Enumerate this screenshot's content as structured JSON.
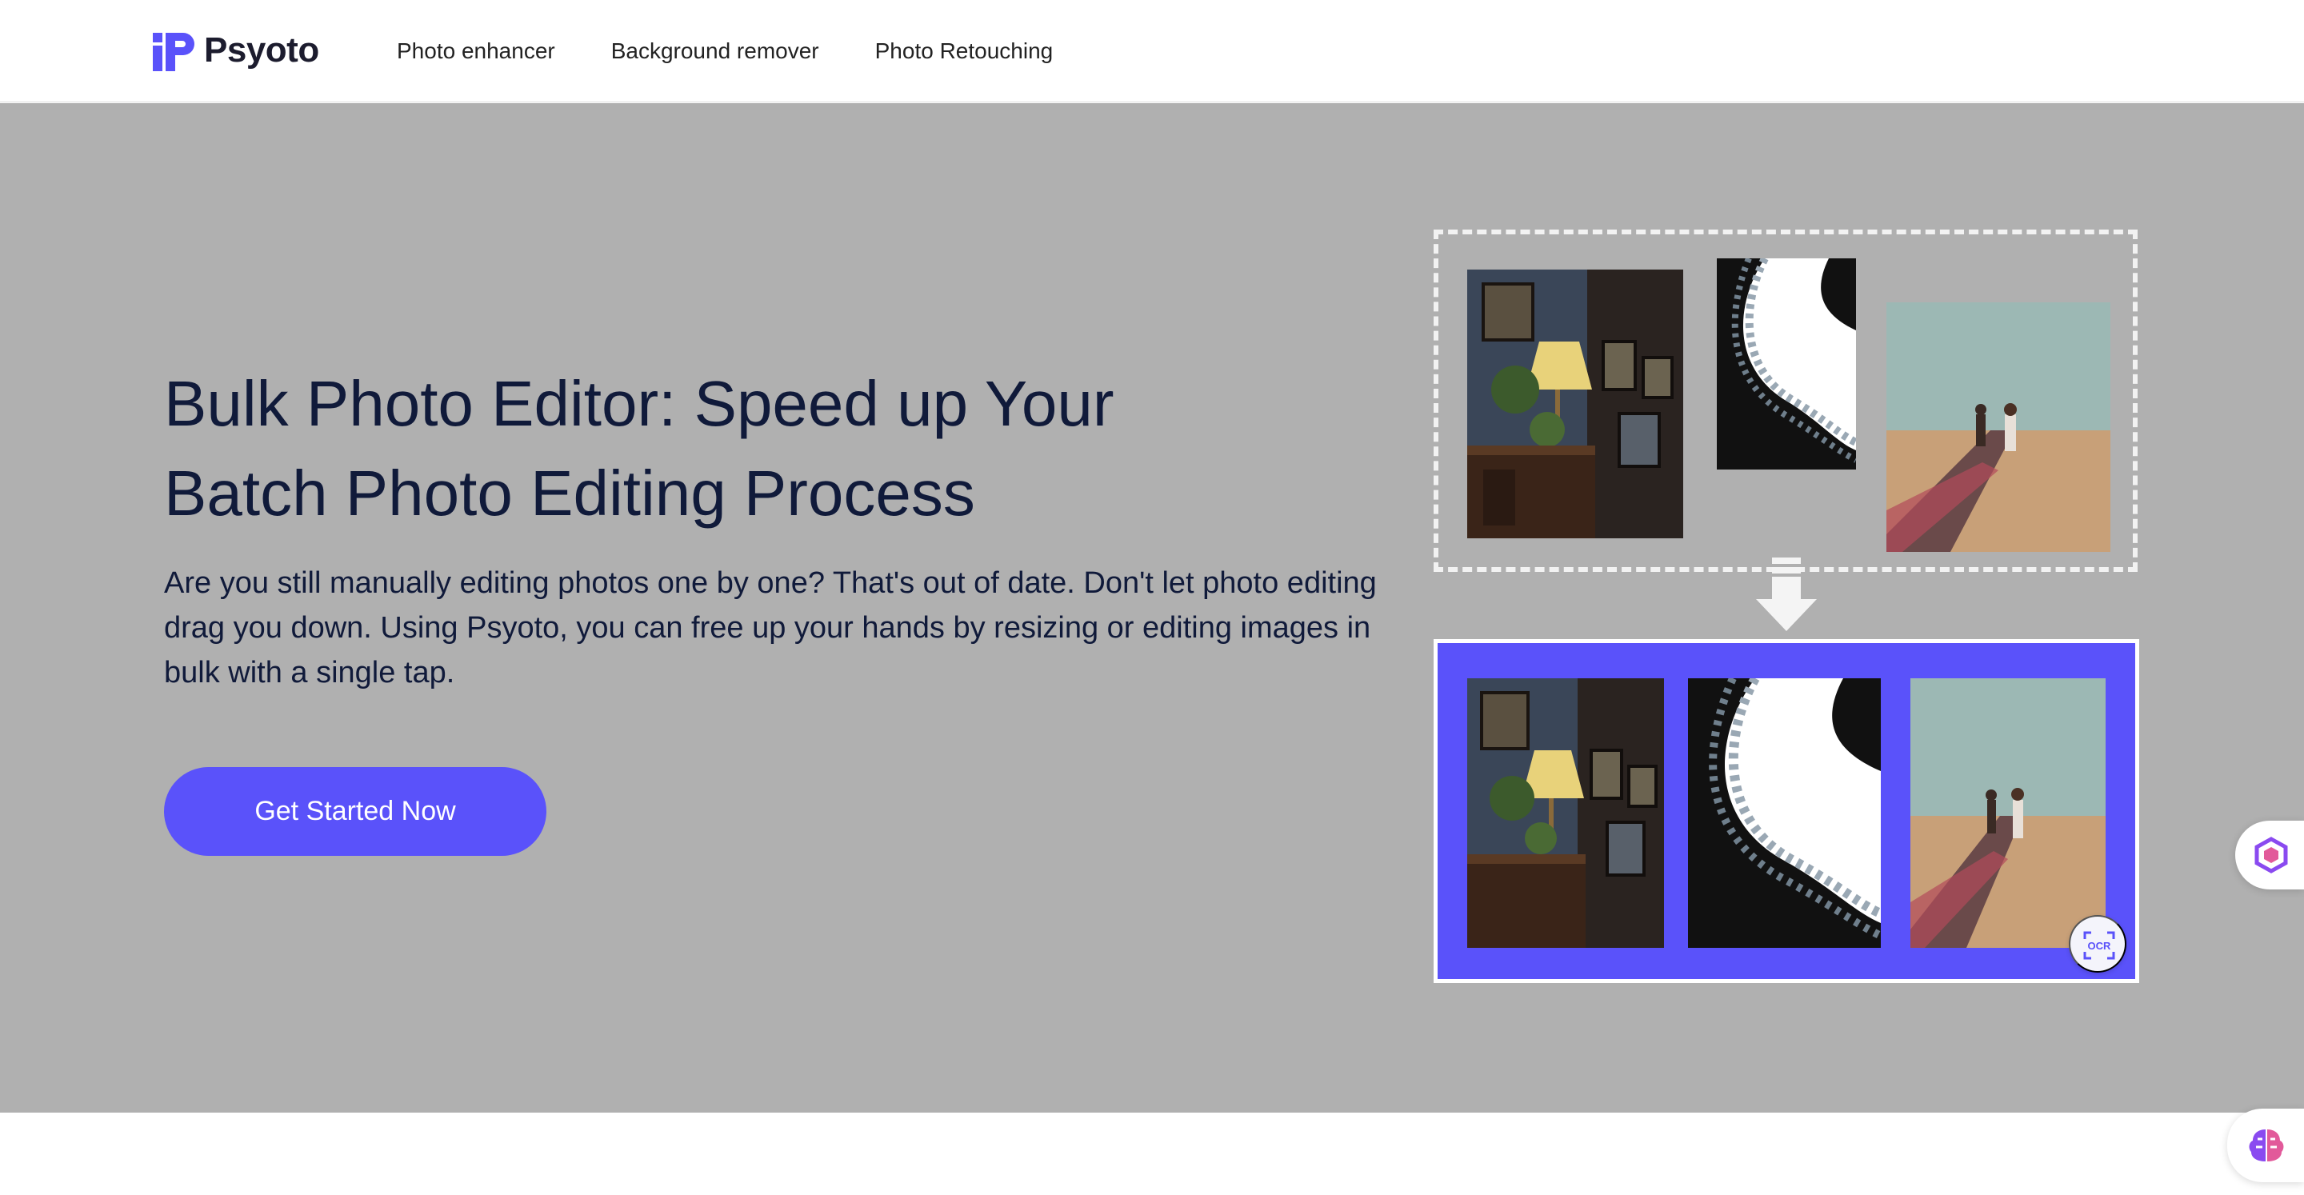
{
  "nav": {
    "brand": "Psyoto",
    "links": [
      "Photo enhancer",
      "Background remover",
      "Photo Retouching"
    ]
  },
  "hero": {
    "title_line1": "Bulk Photo Editor: Speed up Your",
    "title_line2": "Batch Photo Editing Process",
    "description": "Are you still manually editing photos one by one? That's out of date. Don't let photo editing drag you down. Using Psyoto, you can free up your hands by resizing or editing images in bulk with a single tap.",
    "cta_label": "Get Started Now"
  },
  "icons": {
    "logo": "psyoto-logo-icon",
    "arrow": "arrow-down-icon",
    "ocr": "ocr-scan-icon",
    "widget1": "hexagon-app-icon",
    "widget2": "brain-ai-icon"
  },
  "colors": {
    "accent": "#5a52fa",
    "hero_bg": "#b0b0b0",
    "heading": "#101a3a"
  }
}
